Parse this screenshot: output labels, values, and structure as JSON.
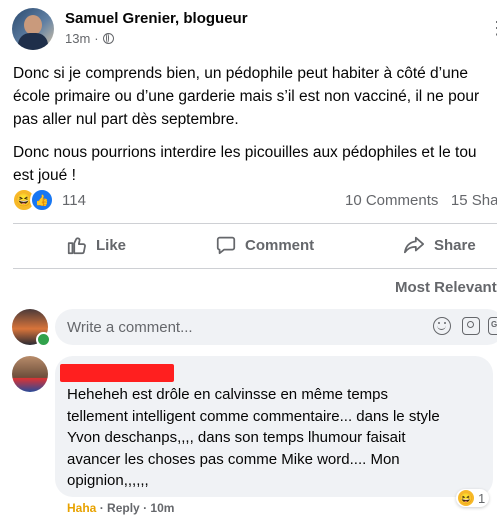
{
  "post": {
    "author": "Samuel Grenier, blogueur",
    "time": "13m",
    "separator": "·",
    "paragraphs": [
      "Donc si je comprends bien, un pédophile peut habiter à côté d’une",
      "école primaire ou d’une garderie mais s’il est non vacciné, il ne pour",
      "pas aller nul part dès septembre.",
      "Donc nous pourrions interdire les picouilles aux pédophiles et le tou",
      "est joué !"
    ],
    "reaction_count": "114",
    "comments_count": "10 Comments",
    "shares_count": "15 Sha"
  },
  "actions": {
    "like": "Like",
    "comment": "Comment",
    "share": "Share"
  },
  "comments_sort": "Most Relevant",
  "composer": {
    "placeholder": "Write a comment...",
    "gif_label": "GIF"
  },
  "comment": {
    "lines": [
      "Heheheh est drôle en calvinsse en même temps",
      "tellement intelligent comme commentaire... dans le style",
      "Yvon deschanps,,,, dans son temps lhumour faisait",
      "avancer les choses pas comme Mike word.... Mon",
      "opignion,,,,,,"
    ],
    "reaction_count": "1",
    "haha": "Haha",
    "dot": "·",
    "reply": "Reply",
    "time": "10m"
  },
  "colors": {
    "accent": "#1877f2",
    "haha": "#f7b928",
    "secondary_text": "#65676b",
    "redaction": "#ff1f1f"
  }
}
